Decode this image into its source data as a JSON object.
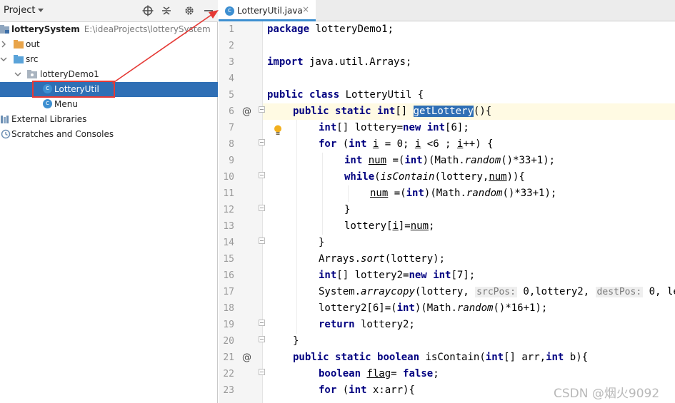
{
  "project_panel": {
    "title": "Project",
    "header_icons": [
      "crosshair-icon",
      "collapse-all-icon",
      "gear-icon",
      "minimize-icon"
    ],
    "tree": [
      {
        "label": "lotterySystem",
        "path": "E:\\ideaProjects\\lotterySystem",
        "icon": "module-folder-icon"
      },
      {
        "label": "out",
        "icon": "folder-icon"
      },
      {
        "label": "src",
        "icon": "source-folder-icon"
      },
      {
        "label": "lotteryDemo1",
        "icon": "package-icon"
      },
      {
        "label": "LotteryUtil",
        "icon": "java-class-icon",
        "selected": true
      },
      {
        "label": "Menu",
        "icon": "java-class-icon"
      },
      {
        "label": "External Libraries",
        "icon": "libraries-icon"
      },
      {
        "label": "Scratches and Consoles",
        "icon": "scratches-icon"
      }
    ]
  },
  "editor": {
    "tab": {
      "label": "LotteryUtil.java",
      "close": "×"
    },
    "line_numbers": [
      "1",
      "2",
      "3",
      "4",
      "5",
      "6",
      "7",
      "8",
      "9",
      "10",
      "11",
      "12",
      "13",
      "14",
      "15",
      "16",
      "17",
      "18",
      "19",
      "20",
      "21",
      "22",
      "23"
    ],
    "gutter_marks": {
      "line6": "@",
      "line21": "@"
    },
    "code": {
      "l1_kw": "package",
      "l1_rest": " lotteryDemo1;",
      "l3_kw": "import",
      "l3_rest": " java.util.Arrays;",
      "l5_kw1": "public",
      "l5_kw2": "class",
      "l5_rest": " LotteryUtil {",
      "l6_kw1": "public",
      "l6_kw2": "static",
      "l6_kw3": "int",
      "l6_a": "[] ",
      "l6_sel": "getLottery",
      "l6_b": "(){",
      "l7_kw1": "int",
      "l7_a": "[] lottery=",
      "l7_kw2": "new",
      "l7_kw3": "int",
      "l7_b": "[6];",
      "l8_kw1": "for",
      "l8_a": " (",
      "l8_kw2": "int",
      "l8_b": " ",
      "l8_i": "i",
      "l8_c": " = 0; ",
      "l8_i2": "i",
      "l8_d": " <6 ; ",
      "l8_i3": "i",
      "l8_e": "++) {",
      "l9_kw1": "int",
      "l9_a": " ",
      "l9_num": "num",
      "l9_b": " =(",
      "l9_kw2": "int",
      "l9_c": ")(Math.",
      "l9_rand": "random",
      "l9_d": "()*33+1);",
      "l10_kw": "while",
      "l10_a": "(",
      "l10_fn": "isContain",
      "l10_b": "(lottery,",
      "l10_num": "num",
      "l10_c": ")){",
      "l11_num": "num",
      "l11_a": " =(",
      "l11_kw": "int",
      "l11_b": ")(Math.",
      "l11_rand": "random",
      "l11_c": "()*33+1);",
      "l12": "}",
      "l13_a": "lottery[",
      "l13_i": "i",
      "l13_b": "]=",
      "l13_num": "num",
      "l13_c": ";",
      "l14": "}",
      "l15_a": "Arrays.",
      "l15_fn": "sort",
      "l15_b": "(lottery);",
      "l16_kw1": "int",
      "l16_a": "[] lottery2=",
      "l16_kw2": "new",
      "l16_kw3": "int",
      "l16_b": "[7];",
      "l17_a": "System.",
      "l17_fn": "arraycopy",
      "l17_b": "(lottery, ",
      "l17_h1": "srcPos:",
      "l17_c": " 0,lottery2, ",
      "l17_h2": "destPos:",
      "l17_d": " 0, le",
      "l18_a": "lottery2[6]=(",
      "l18_kw": "int",
      "l18_b": ")(Math.",
      "l18_rand": "random",
      "l18_c": "()*16+1);",
      "l19_kw": "return",
      "l19_a": " lottery2;",
      "l20": "}",
      "l21_kw1": "public",
      "l21_kw2": "static",
      "l21_kw3": "boolean",
      "l21_a": " isContain(",
      "l21_kw4": "int",
      "l21_b": "[] arr,",
      "l21_kw5": "int",
      "l21_c": " b){",
      "l22_kw1": "boolean",
      "l22_a": " ",
      "l22_flag": "flag",
      "l22_b": "= ",
      "l22_kw2": "false",
      "l22_c": ";",
      "l23_kw1": "for",
      "l23_a": " (",
      "l23_kw2": "int",
      "l23_b": " x:arr){"
    }
  },
  "watermark": "CSDN @烟火9092",
  "colors": {
    "keyword": "#000080",
    "selection": "#2f6fb5",
    "annotation": "#e53935",
    "class_badge": "#3d8fd1"
  }
}
